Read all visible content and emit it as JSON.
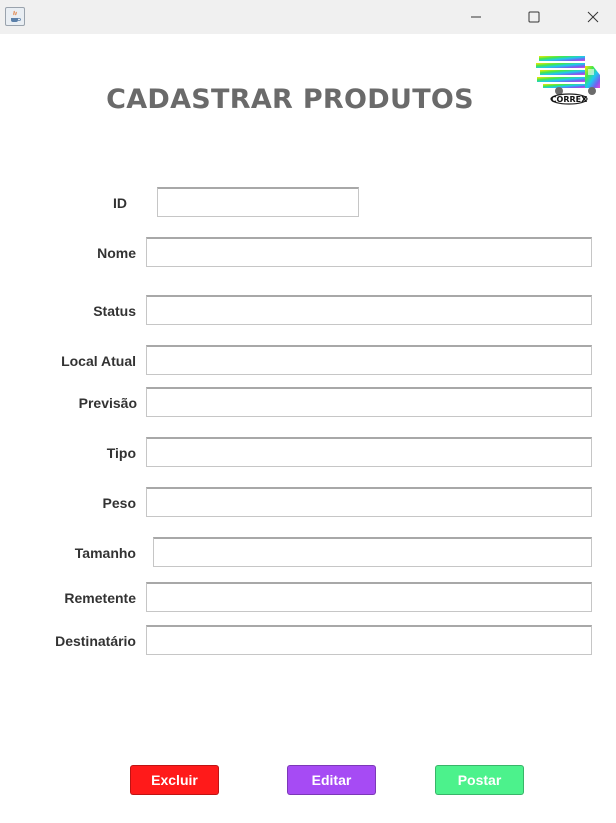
{
  "window": {
    "controls": [
      "minimize-icon",
      "maximize-icon",
      "close-icon"
    ]
  },
  "logo": {
    "text": "CORREX"
  },
  "heading": "CADASTRAR PRODUTOS",
  "form": {
    "id_label": "ID",
    "nome_label": "Nome",
    "status_label": "Status",
    "local_label": "Local Atual",
    "previsao_label": "Previsão",
    "tipo_label": "Tipo",
    "peso_label": "Peso",
    "tamanho_label": "Tamanho",
    "remetente_label": "Remetente",
    "destinatario_label": "Destinatário",
    "values": {
      "id": "",
      "nome": "",
      "status": "",
      "local": "",
      "previsao": "",
      "tipo": "",
      "peso": "",
      "tamanho": "",
      "remetente": "",
      "destinatario": ""
    }
  },
  "actions": {
    "excluir_label": "Excluir",
    "editar_label": "Editar",
    "postar_label": "Postar"
  },
  "colors": {
    "excluir": "#ff1a1a",
    "editar": "#a64bf4",
    "postar": "#4cf28c",
    "heading": "#6a6a6a"
  }
}
